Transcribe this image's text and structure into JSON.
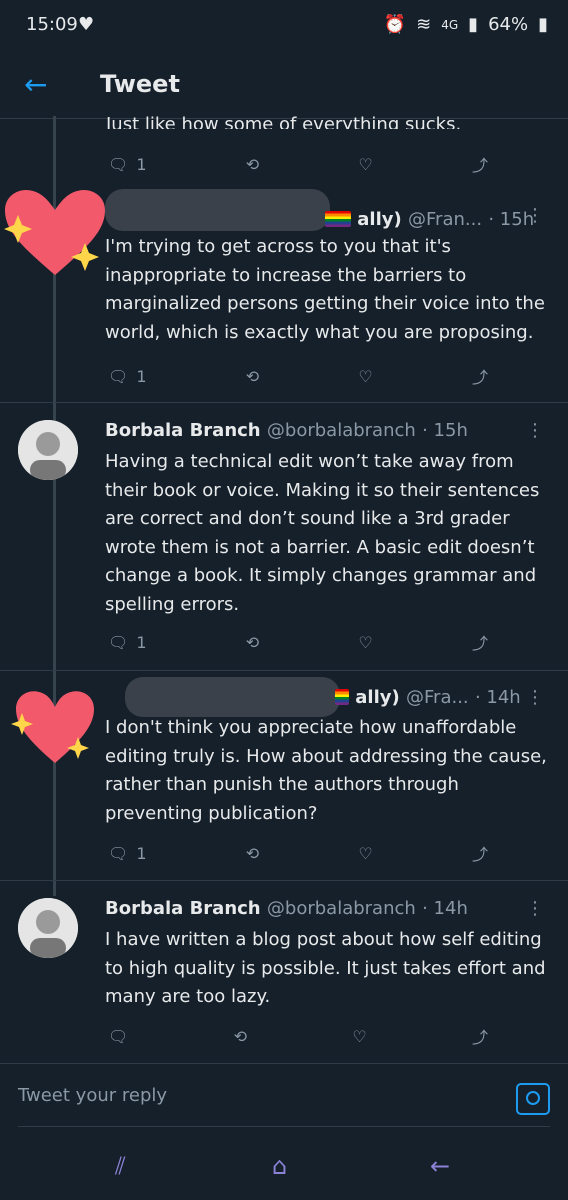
{
  "status": {
    "time": "15:09",
    "network": "4G",
    "battery": "64%"
  },
  "app": {
    "title": "Tweet"
  },
  "top_clipped": "Just like how some of everything sucks.",
  "top_actions": {
    "replies": "1"
  },
  "tweets": [
    {
      "name": "ally)",
      "handle": "@Fran...",
      "time": "· 15h",
      "text": "I'm trying to get across to you that it's inappropriate to increase the barriers to marginalized persons getting their voice into the world, which is exactly what you are proposing.",
      "replies": "1"
    },
    {
      "name": "Borbala Branch",
      "handle": "@borbalabranch",
      "time": "· 15h",
      "text": "Having a technical edit won’t take away from their book or voice. Making it so their sentences are correct and don’t sound like a 3rd grader wrote them is not a barrier. A basic edit doesn’t change a book. It simply changes grammar and spelling errors.",
      "replies": "1"
    },
    {
      "name": "ally)",
      "handle": "@Fra...",
      "time": "· 14h",
      "text": "I don't think you appreciate how unaffordable editing truly is. How about addressing the cause, rather than punish the authors through preventing publication?",
      "replies": "1"
    },
    {
      "name": "Borbala Branch",
      "handle": "@borbalabranch",
      "time": "· 14h",
      "text": "I have written a blog post about how self editing to high quality is possible. It just takes effort and many are too lazy.",
      "replies": ""
    }
  ],
  "reply": {
    "placeholder": "Tweet your reply"
  },
  "colors": {
    "accent": "#1d9bf0",
    "background": "#15202b",
    "muted": "#8b98a5"
  }
}
